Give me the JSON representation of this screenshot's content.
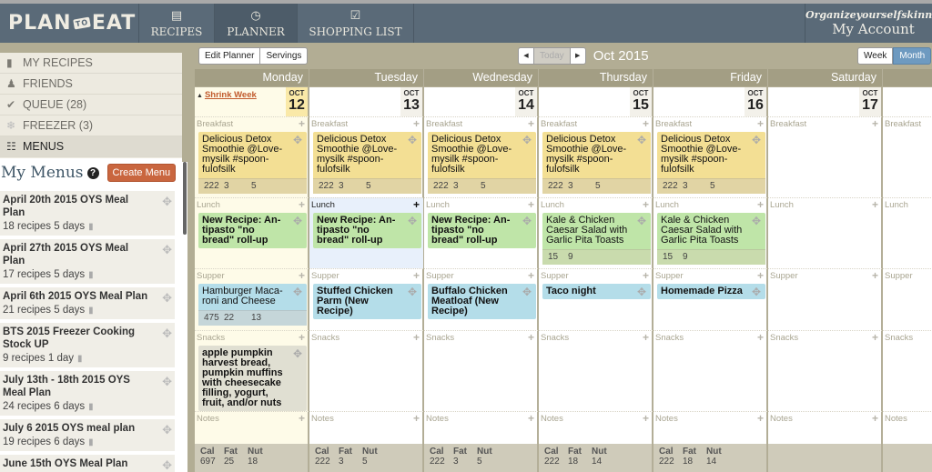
{
  "header": {
    "logo": {
      "left": "PLAN",
      "mid": "TO",
      "right": "EAT"
    },
    "nav": [
      {
        "label": "RECIPES",
        "icon": "recipe-cards-icon"
      },
      {
        "label": "PLANNER",
        "icon": "clock-icon",
        "active": true
      },
      {
        "label": "SHOPPING LIST",
        "icon": "checkbox-icon"
      }
    ],
    "account": {
      "username": "Organizeyourselfskinny",
      "label": "My Account"
    }
  },
  "sidebar": {
    "items": [
      {
        "label": "MY RECIPES",
        "icon": "book-icon"
      },
      {
        "label": "FRIENDS",
        "icon": "person-icon"
      },
      {
        "label": "QUEUE (28)",
        "icon": "check-icon"
      },
      {
        "label": "FREEZER (3)",
        "icon": "snowflake-icon"
      },
      {
        "label": "MENUS",
        "icon": "open-book-icon",
        "active": true
      }
    ],
    "menus": {
      "title": "My Menus",
      "help": "?",
      "create_label": "Create Menu",
      "list": [
        {
          "name": "April 20th 2015 OYS Meal Plan",
          "recipes": "18 recipes",
          "days": "5 days"
        },
        {
          "name": "April 27th 2015 OYS Meal Plan",
          "recipes": "17 recipes",
          "days": "5 days"
        },
        {
          "name": "April 6th 2015 OYS Meal Plan",
          "recipes": "21 recipes",
          "days": "5 days"
        },
        {
          "name": "BTS 2015 Freezer Cooking Stock UP",
          "recipes": "9 recipes",
          "days": "1 day"
        },
        {
          "name": "July 13th - 18th 2015 OYS Meal Plan",
          "recipes": "24 recipes",
          "days": "6 days"
        },
        {
          "name": "July 6 2015 OYS meal plan",
          "recipes": "19 recipes",
          "days": "6 days"
        },
        {
          "name": "June 15th OYS Meal Plan",
          "recipes": "",
          "days": ""
        }
      ]
    }
  },
  "toolbar": {
    "edit_planner": "Edit Planner",
    "servings": "Servings",
    "prev": "◀",
    "today": "Today",
    "next": "▶",
    "month_label": "Oct 2015",
    "week": "Week",
    "month": "Month"
  },
  "calendar": {
    "shrink_week": "Shrink Week",
    "slot_labels": [
      "Breakfast",
      "Lunch",
      "Supper",
      "Snacks",
      "Notes"
    ],
    "footer_labels": {
      "cal": "Cal",
      "fat": "Fat",
      "nut": "Nut"
    },
    "days": [
      {
        "name": "Monday",
        "month": "OCT",
        "date": "12",
        "today": true,
        "meals": {
          "breakfast": {
            "name": "Delicious Detox Smoothie @Love-mysilk #spoon-fulofsilk",
            "color": "yellow",
            "stats": [
              "222",
              "3",
              "5"
            ]
          },
          "lunch": {
            "name": "New Recipe: An-tipasto \"no bread\" roll-up",
            "color": "green",
            "bold": true
          },
          "supper": {
            "name": "Hamburger Maca-roni and Cheese",
            "color": "blue",
            "stats": [
              "475",
              "22",
              "13"
            ]
          },
          "snacks": {
            "name": "apple pumpkin harvest bread, pumpkin muffins with cheesecake filling, yogurt, fruit, and/or nuts",
            "color": "gray",
            "bold": true
          }
        },
        "totals": {
          "cal": "697",
          "fat": "25",
          "nut": "18"
        }
      },
      {
        "name": "Tuesday",
        "month": "OCT",
        "date": "13",
        "meals": {
          "breakfast": {
            "name": "Delicious Detox Smoothie @Love-mysilk #spoon-fulofsilk",
            "color": "yellow",
            "stats": [
              "222",
              "3",
              "5"
            ]
          },
          "lunch": {
            "name": "New Recipe: An-tipasto \"no bread\" roll-up",
            "color": "green",
            "bold": true
          },
          "supper": {
            "name": "Stuffed Chicken Parm (New Recipe)",
            "color": "blue",
            "bold": true
          }
        },
        "lunch_highlight": true,
        "totals": {
          "cal": "222",
          "fat": "3",
          "nut": "5"
        }
      },
      {
        "name": "Wednesday",
        "month": "OCT",
        "date": "14",
        "meals": {
          "breakfast": {
            "name": "Delicious Detox Smoothie @Love-mysilk #spoon-fulofsilk",
            "color": "yellow",
            "stats": [
              "222",
              "3",
              "5"
            ]
          },
          "lunch": {
            "name": "New Recipe: An-tipasto \"no bread\" roll-up",
            "color": "green",
            "bold": true
          },
          "supper": {
            "name": "Buffalo Chicken Meatloaf (New Recipe)",
            "color": "blue",
            "bold": true
          }
        },
        "totals": {
          "cal": "222",
          "fat": "3",
          "nut": "5"
        }
      },
      {
        "name": "Thursday",
        "month": "OCT",
        "date": "15",
        "meals": {
          "breakfast": {
            "name": "Delicious Detox Smoothie @Love-mysilk #spoon-fulofsilk",
            "color": "yellow",
            "stats": [
              "222",
              "3",
              "5"
            ]
          },
          "lunch": {
            "name": "Kale & Chicken Caesar Salad with Garlic Pita Toasts",
            "color": "green",
            "stats": [
              "15",
              "9",
              ""
            ]
          },
          "supper": {
            "name": "Taco night",
            "color": "blue",
            "bold": true
          }
        },
        "totals": {
          "cal": "222",
          "fat": "18",
          "nut": "14"
        }
      },
      {
        "name": "Friday",
        "month": "OCT",
        "date": "16",
        "meals": {
          "breakfast": {
            "name": "Delicious Detox Smoothie @Love-mysilk #spoon-fulofsilk",
            "color": "yellow",
            "stats": [
              "222",
              "3",
              "5"
            ]
          },
          "lunch": {
            "name": "Kale & Chicken Caesar Salad with Garlic Pita Toasts",
            "color": "green",
            "stats": [
              "15",
              "9",
              ""
            ]
          },
          "supper": {
            "name": "Homemade Pizza",
            "color": "blue",
            "bold": true
          }
        },
        "totals": {
          "cal": "222",
          "fat": "18",
          "nut": "14"
        }
      },
      {
        "name": "Saturday",
        "month": "OCT",
        "date": "17",
        "meals": {},
        "totals": null
      },
      {
        "name": "",
        "month": "",
        "date": "",
        "meals": {},
        "totals": null
      }
    ]
  },
  "colors": {
    "header": "#5a6a78",
    "accent_orange": "#c9663f",
    "month_toggle": "#6e9ac0",
    "card_yellow": "#f3df94",
    "card_green": "#bfe5a8",
    "card_blue": "#b4dde9"
  }
}
